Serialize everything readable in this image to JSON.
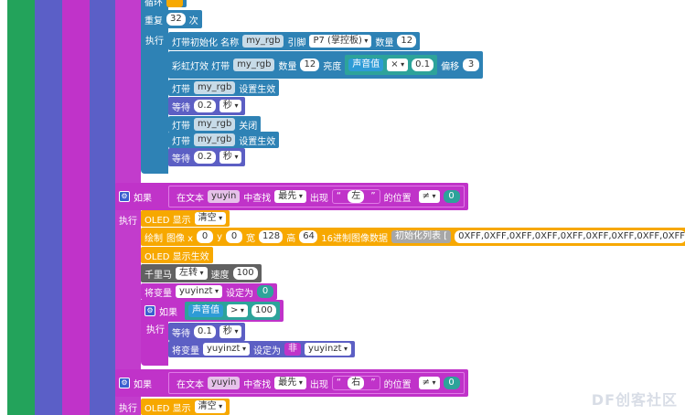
{
  "colors": {
    "green": "#23a35b",
    "indigo": "#5b5fc7",
    "magenta": "#c033c9",
    "blue": "#2e82b5",
    "purple": "#5c5fc4",
    "orange": "#f7a800",
    "gray": "#616161",
    "teal": "#2da39a",
    "pink": "#c23ccc"
  },
  "loop": {
    "label": "循环",
    "repeat": "重复",
    "count": "32",
    "times": "次",
    "do": "执行"
  },
  "strip": {
    "init": "灯带初始化 名称",
    "name": "my_rgb",
    "pin_label": "引脚",
    "pin": "P7 (掌控板)",
    "count_label": "数量",
    "count": "12"
  },
  "rainbow": {
    "label": "彩虹灯效 灯带",
    "name": "my_rgb",
    "count_label": "数量",
    "count": "12",
    "bright_label": "亮度",
    "sound": "声音值",
    "op": "×",
    "val": "0.1",
    "offset_label": "偏移",
    "offset": "3"
  },
  "apply1": {
    "a": "灯带",
    "name": "my_rgb",
    "b": "设置生效"
  },
  "wait1": {
    "a": "等待",
    "val": "0.2",
    "unit": "秒"
  },
  "off": {
    "a": "灯带",
    "name": "my_rgb",
    "b": "关闭"
  },
  "apply2": {
    "a": "灯带",
    "name": "my_rgb",
    "b": "设置生效"
  },
  "wait2": {
    "a": "等待",
    "val": "0.2",
    "unit": "秒"
  },
  "if1": {
    "if": "如果",
    "find": "在文本",
    "var": "yuyin",
    "mid": "中查找",
    "mode": "最先",
    "appear": "出现",
    "q1": "“",
    "word": "左",
    "q2": "”",
    "pos": "的位置",
    "cmp": "≠",
    "zero": "0",
    "do": "执行"
  },
  "oled1": {
    "a": "OLED 显示",
    "b": "清空"
  },
  "draw": {
    "a": "绘制",
    "img": "图像 x",
    "x": "0",
    "y_label": "y",
    "y": "0",
    "w_label": "宽",
    "w": "128",
    "h_label": "高",
    "h": "64",
    "hex": "16进制图像数据",
    "init": "初始化列表 [",
    "data": "0XFF,0XFF,0XFF,0XFF,0XFF,0XFF,0XFF,0XFF,0XFF,0"
  },
  "oled_apply": {
    "a": "OLED 显示生效"
  },
  "motor": {
    "a": "千里马",
    "dir": "左转",
    "speed_label": "速度",
    "speed": "100"
  },
  "setvar": {
    "a": "将变量",
    "var": "yuyinzt",
    "b": "设定为",
    "val": "0"
  },
  "if2": {
    "if": "如果",
    "sound": "声音值",
    "op": ">",
    "val": "100",
    "do": "执行"
  },
  "wait3": {
    "a": "等待",
    "val": "0.1",
    "unit": "秒"
  },
  "setvar2": {
    "a": "将变量",
    "var": "yuyinzt",
    "b": "设定为",
    "not": "非",
    "val": "yuyinzt"
  },
  "if3": {
    "if": "如果",
    "find": "在文本",
    "var": "yuyin",
    "mid": "中查找",
    "mode": "最先",
    "appear": "出现",
    "q1": "“",
    "word": "右",
    "q2": "”",
    "pos": "的位置",
    "cmp": "≠",
    "zero": "0",
    "do": "执行"
  },
  "oled2": {
    "a": "OLED 显示",
    "b": "清空"
  },
  "watermark": "DF创客社区"
}
